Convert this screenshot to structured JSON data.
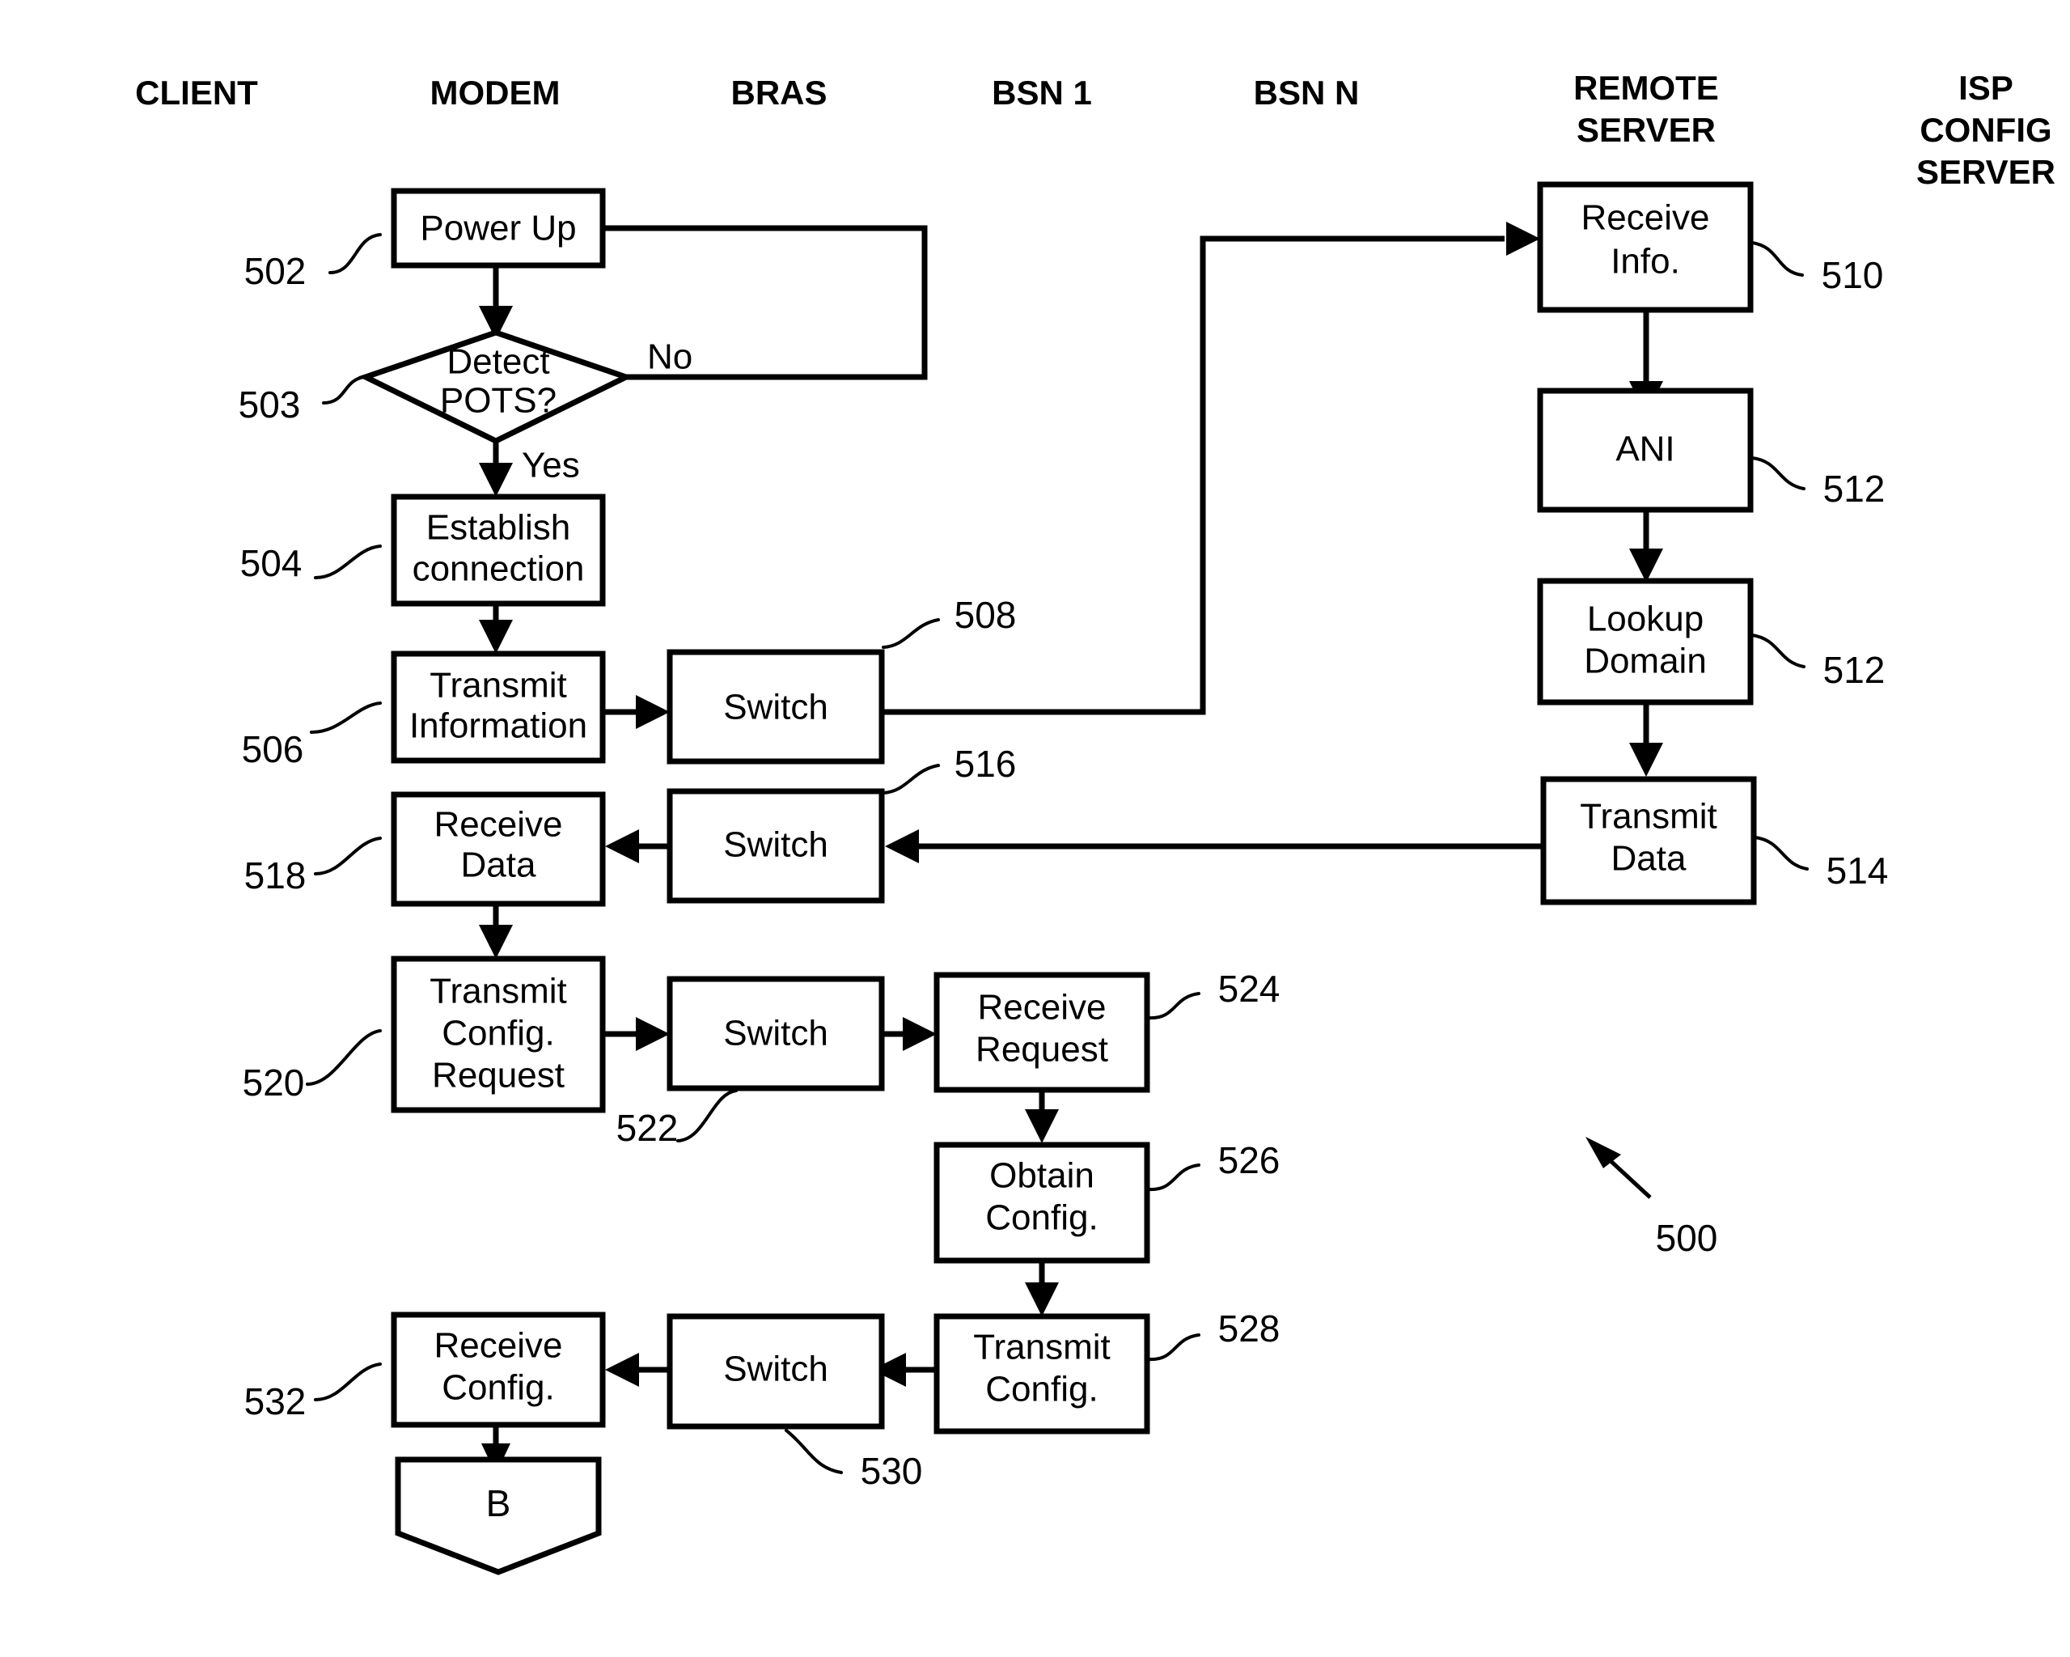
{
  "figure": {
    "label": "500",
    "title": "Patent flowchart FIG. 5 - modem configuration sequence"
  },
  "columns": [
    {
      "id": "client",
      "label": "CLIENT"
    },
    {
      "id": "modem",
      "label": "MODEM"
    },
    {
      "id": "bras",
      "label": "BRAS"
    },
    {
      "id": "bsn1",
      "label": "BSN 1"
    },
    {
      "id": "bsnN",
      "label": "BSN N"
    },
    {
      "id": "remote-server",
      "label_line1": "REMOTE",
      "label_line2": "SERVER"
    },
    {
      "id": "isp-config-server",
      "label_line1": "ISP",
      "label_line2": "CONFIG",
      "label_line3": "SERVER"
    }
  ],
  "nodes": [
    {
      "id": "power-up",
      "ref": "502",
      "shape": "process",
      "line1": "Power Up",
      "line2": "",
      "line3": ""
    },
    {
      "id": "detect-pots",
      "ref": "503",
      "shape": "decision",
      "line1": "Detect",
      "line2": "POTS?",
      "line3": ""
    },
    {
      "id": "establish-connection",
      "ref": "504",
      "shape": "process",
      "line1": "Establish",
      "line2": "connection",
      "line3": ""
    },
    {
      "id": "transmit-information",
      "ref": "506",
      "shape": "process",
      "line1": "Transmit",
      "line2": "Information",
      "line3": ""
    },
    {
      "id": "switch-508",
      "ref": "508",
      "shape": "process",
      "line1": "Switch",
      "line2": "",
      "line3": ""
    },
    {
      "id": "receive-info",
      "ref": "510",
      "shape": "process",
      "line1": "Receive",
      "line2": "Info.",
      "line3": ""
    },
    {
      "id": "ani",
      "ref": "512",
      "shape": "process",
      "line1": "ANI",
      "line2": "",
      "line3": ""
    },
    {
      "id": "lookup-domain",
      "ref": "512",
      "shape": "process",
      "line1": "Lookup",
      "line2": "Domain",
      "line3": ""
    },
    {
      "id": "transmit-data",
      "ref": "514",
      "shape": "process",
      "line1": "Transmit",
      "line2": "Data",
      "line3": ""
    },
    {
      "id": "switch-516",
      "ref": "516",
      "shape": "process",
      "line1": "Switch",
      "line2": "",
      "line3": ""
    },
    {
      "id": "receive-data",
      "ref": "518",
      "shape": "process",
      "line1": "Receive",
      "line2": "Data",
      "line3": ""
    },
    {
      "id": "transmit-config-request",
      "ref": "520",
      "shape": "process",
      "line1": "Transmit",
      "line2": "Config.",
      "line3": "Request"
    },
    {
      "id": "switch-522",
      "ref": "522",
      "shape": "process",
      "line1": "Switch",
      "line2": "",
      "line3": ""
    },
    {
      "id": "receive-request",
      "ref": "524",
      "shape": "process",
      "line1": "Receive",
      "line2": "Request",
      "line3": ""
    },
    {
      "id": "obtain-config",
      "ref": "526",
      "shape": "process",
      "line1": "Obtain",
      "line2": "Config.",
      "line3": ""
    },
    {
      "id": "transmit-config",
      "ref": "528",
      "shape": "process",
      "line1": "Transmit",
      "line2": "Config.",
      "line3": ""
    },
    {
      "id": "switch-530",
      "ref": "530",
      "shape": "process",
      "line1": "Switch",
      "line2": "",
      "line3": ""
    },
    {
      "id": "receive-config",
      "ref": "532",
      "shape": "process",
      "line1": "Receive",
      "line2": "Config.",
      "line3": ""
    },
    {
      "id": "connector-b",
      "ref": "",
      "shape": "connector",
      "line1": "B",
      "line2": "",
      "line3": ""
    }
  ],
  "edge_labels": {
    "no": "No",
    "yes": "Yes"
  },
  "colors": {
    "stroke": "#000000",
    "fill": "#ffffff",
    "background": "#ffffff"
  }
}
